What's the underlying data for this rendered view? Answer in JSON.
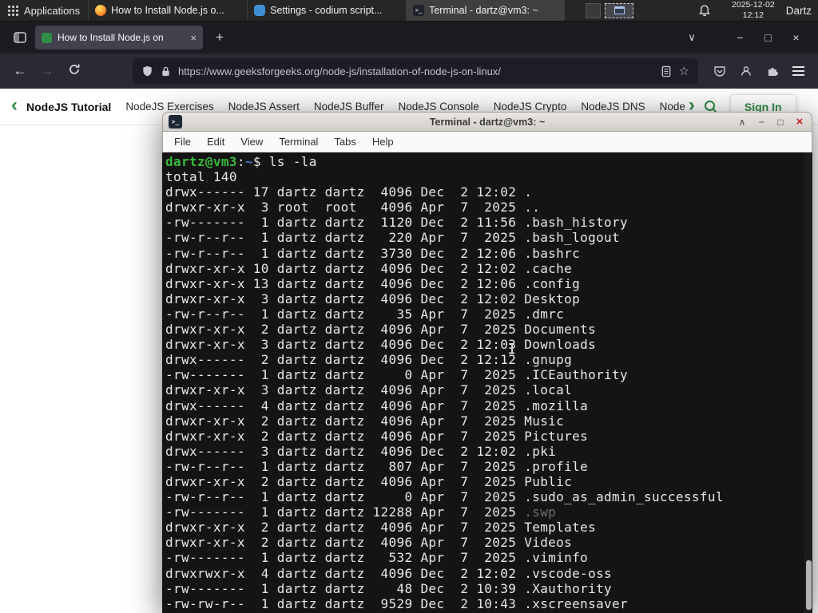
{
  "colors": {
    "gfg_green": "#2f8d46",
    "terminal_green": "#3ab93a",
    "terminal_blue": "#4a7dcd",
    "close_red": "#cc1f1f"
  },
  "icons": {
    "close": "×",
    "plus": "+",
    "minimize": "−",
    "maximize": "□",
    "shade": "∧",
    "chevron_down": "∨",
    "back": "←",
    "forward": "→",
    "star": "☆",
    "nav_left": "‹",
    "nav_right": "›",
    "prompt_glyph": ">_"
  },
  "panel": {
    "applications_label": "Applications",
    "tasks": [
      {
        "title": "How to Install Node.js o...",
        "app": "firefox"
      },
      {
        "title": "Settings - codium script...",
        "app": "codium"
      },
      {
        "title": "Terminal - dartz@vm3: ~",
        "app": "terminal"
      }
    ],
    "clock_date": "2025-12-02",
    "clock_time": "12:12",
    "user": "Dartz"
  },
  "browser": {
    "tab_title": "How to Install Node.js on",
    "url": "https://www.geeksforgeeks.org/node-js/installation-of-node-js-on-linux/",
    "nav_items": [
      "NodeJS Tutorial",
      "NodeJS Exercises",
      "NodeJS Assert",
      "NodeJS Buffer",
      "NodeJS Console",
      "NodeJS Crypto",
      "NodeJS DNS",
      "Node"
    ],
    "sign_in_label": "Sign In"
  },
  "terminal": {
    "window_title": "Terminal - dartz@vm3: ~",
    "menu": [
      "File",
      "Edit",
      "View",
      "Terminal",
      "Tabs",
      "Help"
    ],
    "prompt": {
      "user": "dartz@vm3",
      "colon": ":",
      "path": "~",
      "symbol": "$ ",
      "command": "ls -la"
    },
    "total_line": "total 140",
    "listing": [
      {
        "perms": "drwx------",
        "links": 17,
        "owner": "dartz",
        "group": "dartz",
        "size": 4096,
        "month": "Dec",
        "day": 2,
        "time": "12:02",
        "name": ".",
        "kind": "dir"
      },
      {
        "perms": "drwxr-xr-x",
        "links": 3,
        "owner": "root",
        "group": "root",
        "size": 4096,
        "month": "Apr",
        "day": 7,
        "time": "2025",
        "name": "..",
        "kind": "dir"
      },
      {
        "perms": "-rw-------",
        "links": 1,
        "owner": "dartz",
        "group": "dartz",
        "size": 1120,
        "month": "Dec",
        "day": 2,
        "time": "11:56",
        "name": ".bash_history",
        "kind": ""
      },
      {
        "perms": "-rw-r--r--",
        "links": 1,
        "owner": "dartz",
        "group": "dartz",
        "size": 220,
        "month": "Apr",
        "day": 7,
        "time": "2025",
        "name": ".bash_logout",
        "kind": ""
      },
      {
        "perms": "-rw-r--r--",
        "links": 1,
        "owner": "dartz",
        "group": "dartz",
        "size": 3730,
        "month": "Dec",
        "day": 2,
        "time": "12:06",
        "name": ".bashrc",
        "kind": ""
      },
      {
        "perms": "drwxr-xr-x",
        "links": 10,
        "owner": "dartz",
        "group": "dartz",
        "size": 4096,
        "month": "Dec",
        "day": 2,
        "time": "12:02",
        "name": ".cache",
        "kind": "dir"
      },
      {
        "perms": "drwxr-xr-x",
        "links": 13,
        "owner": "dartz",
        "group": "dartz",
        "size": 4096,
        "month": "Dec",
        "day": 2,
        "time": "12:06",
        "name": ".config",
        "kind": "dir"
      },
      {
        "perms": "drwxr-xr-x",
        "links": 3,
        "owner": "dartz",
        "group": "dartz",
        "size": 4096,
        "month": "Dec",
        "day": 2,
        "time": "12:02",
        "name": "Desktop",
        "kind": "dir"
      },
      {
        "perms": "-rw-r--r--",
        "links": 1,
        "owner": "dartz",
        "group": "dartz",
        "size": 35,
        "month": "Apr",
        "day": 7,
        "time": "2025",
        "name": ".dmrc",
        "kind": ""
      },
      {
        "perms": "drwxr-xr-x",
        "links": 2,
        "owner": "dartz",
        "group": "dartz",
        "size": 4096,
        "month": "Apr",
        "day": 7,
        "time": "2025",
        "name": "Documents",
        "kind": "dir"
      },
      {
        "perms": "drwxr-xr-x",
        "links": 3,
        "owner": "dartz",
        "group": "dartz",
        "size": 4096,
        "month": "Dec",
        "day": 2,
        "time": "12:03",
        "name": "Downloads",
        "kind": "dir"
      },
      {
        "perms": "drwx------",
        "links": 2,
        "owner": "dartz",
        "group": "dartz",
        "size": 4096,
        "month": "Dec",
        "day": 2,
        "time": "12:12",
        "name": ".gnupg",
        "kind": "dir"
      },
      {
        "perms": "-rw-------",
        "links": 1,
        "owner": "dartz",
        "group": "dartz",
        "size": 0,
        "month": "Apr",
        "day": 7,
        "time": "2025",
        "name": ".ICEauthority",
        "kind": ""
      },
      {
        "perms": "drwxr-xr-x",
        "links": 3,
        "owner": "dartz",
        "group": "dartz",
        "size": 4096,
        "month": "Apr",
        "day": 7,
        "time": "2025",
        "name": ".local",
        "kind": "dir"
      },
      {
        "perms": "drwx------",
        "links": 4,
        "owner": "dartz",
        "group": "dartz",
        "size": 4096,
        "month": "Apr",
        "day": 7,
        "time": "2025",
        "name": ".mozilla",
        "kind": "dir"
      },
      {
        "perms": "drwxr-xr-x",
        "links": 2,
        "owner": "dartz",
        "group": "dartz",
        "size": 4096,
        "month": "Apr",
        "day": 7,
        "time": "2025",
        "name": "Music",
        "kind": "dir"
      },
      {
        "perms": "drwxr-xr-x",
        "links": 2,
        "owner": "dartz",
        "group": "dartz",
        "size": 4096,
        "month": "Apr",
        "day": 7,
        "time": "2025",
        "name": "Pictures",
        "kind": "dir"
      },
      {
        "perms": "drwx------",
        "links": 3,
        "owner": "dartz",
        "group": "dartz",
        "size": 4096,
        "month": "Dec",
        "day": 2,
        "time": "12:02",
        "name": ".pki",
        "kind": "dir"
      },
      {
        "perms": "-rw-r--r--",
        "links": 1,
        "owner": "dartz",
        "group": "dartz",
        "size": 807,
        "month": "Apr",
        "day": 7,
        "time": "2025",
        "name": ".profile",
        "kind": ""
      },
      {
        "perms": "drwxr-xr-x",
        "links": 2,
        "owner": "dartz",
        "group": "dartz",
        "size": 4096,
        "month": "Apr",
        "day": 7,
        "time": "2025",
        "name": "Public",
        "kind": "dir"
      },
      {
        "perms": "-rw-r--r--",
        "links": 1,
        "owner": "dartz",
        "group": "dartz",
        "size": 0,
        "month": "Apr",
        "day": 7,
        "time": "2025",
        "name": ".sudo_as_admin_successful",
        "kind": ""
      },
      {
        "perms": "-rw-------",
        "links": 1,
        "owner": "dartz",
        "group": "dartz",
        "size": 12288,
        "month": "Apr",
        "day": 7,
        "time": "2025",
        "name": ".swp",
        "kind": "dim"
      },
      {
        "perms": "drwxr-xr-x",
        "links": 2,
        "owner": "dartz",
        "group": "dartz",
        "size": 4096,
        "month": "Apr",
        "day": 7,
        "time": "2025",
        "name": "Templates",
        "kind": "dir"
      },
      {
        "perms": "drwxr-xr-x",
        "links": 2,
        "owner": "dartz",
        "group": "dartz",
        "size": 4096,
        "month": "Apr",
        "day": 7,
        "time": "2025",
        "name": "Videos",
        "kind": "dir"
      },
      {
        "perms": "-rw-------",
        "links": 1,
        "owner": "dartz",
        "group": "dartz",
        "size": 532,
        "month": "Apr",
        "day": 7,
        "time": "2025",
        "name": ".viminfo",
        "kind": ""
      },
      {
        "perms": "drwxrwxr-x",
        "links": 4,
        "owner": "dartz",
        "group": "dartz",
        "size": 4096,
        "month": "Dec",
        "day": 2,
        "time": "12:02",
        "name": ".vscode-oss",
        "kind": "dir"
      },
      {
        "perms": "-rw-------",
        "links": 1,
        "owner": "dartz",
        "group": "dartz",
        "size": 48,
        "month": "Dec",
        "day": 2,
        "time": "10:39",
        "name": ".Xauthority",
        "kind": ""
      },
      {
        "perms": "-rw-rw-r--",
        "links": 1,
        "owner": "dartz",
        "group": "dartz",
        "size": 9529,
        "month": "Dec",
        "day": 2,
        "time": "10:43",
        "name": ".xscreensaver",
        "kind": ""
      }
    ]
  }
}
